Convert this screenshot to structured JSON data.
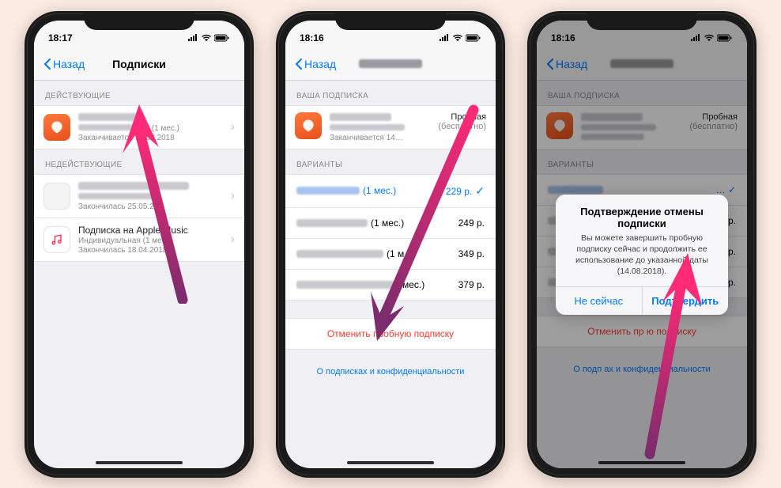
{
  "phone1": {
    "time": "18:17",
    "back": "Назад",
    "title": "Подписки",
    "section_active": "ДЕЙСТВУЮЩИЕ",
    "sub_duration": "(1 мес.)",
    "sub_expiry": "Заканчивается 14.08.2018",
    "section_inactive": "НЕДЕЙСТВУЮЩИЕ",
    "inactive1_expired": "Закончилась 25.05.2…",
    "inactive2_title": "Подписка на Apple Music",
    "inactive2_sub": "Индивидуальная (1 мес…",
    "inactive2_expired": "Закончилась 18.04.2018"
  },
  "phone2": {
    "time": "18:16",
    "back": "Назад",
    "section_sub": "ВАША ПОДПИСКА",
    "trial_label": "Пробная",
    "trial_free": "(бесплатно)",
    "sub_expiry": "Заканчивается 14…",
    "section_variants": "ВАРИАНТЫ",
    "variants": [
      {
        "dur": "(1 мес.)",
        "price": "229 р.",
        "selected": true
      },
      {
        "dur": "(1 мес.)",
        "price": "249 р.",
        "selected": false
      },
      {
        "dur": "(1 м…",
        "price": "349 р.",
        "selected": false
      },
      {
        "dur": "мес.)",
        "price": "379 р.",
        "selected": false
      }
    ],
    "cancel": "Отменить пробную подписку",
    "privacy": "О подписках и конфиденциальности"
  },
  "phone3": {
    "time": "18:16",
    "back": "Назад",
    "section_sub": "ВАША ПОДПИСКА",
    "trial_label": "Пробная",
    "trial_free": "(бесплатно)",
    "section_variants": "ВАРИАНТЫ",
    "alert_title": "Подтверждение отмены подписки",
    "alert_msg": "Вы можете завершить пробную подписку сейчас и продолжить ее использование до указанной даты (14.08.2018).",
    "alert_cancel": "Не сейчас",
    "alert_confirm": "Подтвердить",
    "cancel_partial": "Отменить пр         ю подписку",
    "privacy_partial": "О подп     ах и конфиденциальности"
  }
}
